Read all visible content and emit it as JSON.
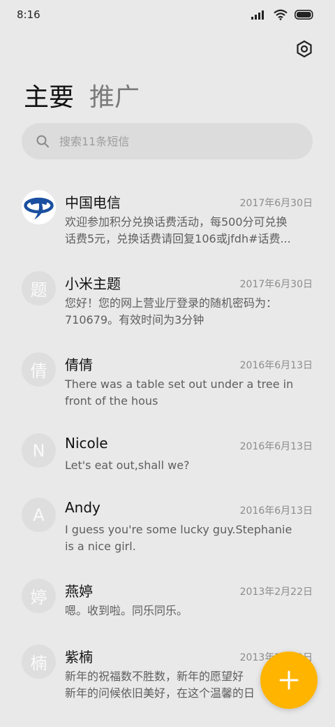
{
  "status_bar": {
    "time": "8:16"
  },
  "tabs": [
    {
      "label": "主要",
      "active": true
    },
    {
      "label": "推广",
      "active": false
    }
  ],
  "search": {
    "placeholder": "搜索11条短信"
  },
  "icons": {
    "settings": "hexagon-settings-icon",
    "search": "search-icon",
    "compose": "plus-icon",
    "telecom_logo": "china-telecom-logo"
  },
  "colors": {
    "accent": "#ffb400",
    "telecom_blue": "#1a4fa0"
  },
  "conversations": [
    {
      "avatar": "",
      "name": "中国电信",
      "date": "2017年6月30日",
      "preview": [
        "欢迎参加积分兑换话费活动，每500分可兑换",
        "话费5元，兑换话费请回复106或jfdh#话费..."
      ]
    },
    {
      "avatar": "题",
      "name": "小米主题",
      "date": "2017年6月30日",
      "preview": [
        "您好！您的网上营业厅登录的随机密码为：",
        "710679。有效时间为3分钟"
      ]
    },
    {
      "avatar": "倩",
      "name": "倩倩",
      "date": "2016年6月13日",
      "preview": [
        "There was a table set out under a tree in",
        "front of the hous"
      ]
    },
    {
      "avatar": "N",
      "name": "Nicole",
      "date": "2016年6月13日",
      "preview": [
        "Let's eat out,shall we?"
      ]
    },
    {
      "avatar": "A",
      "name": "Andy",
      "date": "2016年6月13日",
      "preview": [
        "I guess you're some lucky guy.Stephanie",
        "is a nice girl."
      ]
    },
    {
      "avatar": "婷",
      "name": "燕婷",
      "date": "2013年2月22日",
      "preview": [
        "嗯。收到啦。同乐同乐。"
      ]
    },
    {
      "avatar": "楠",
      "name": "紫楠",
      "date": "2013年2月22日",
      "preview": [
        "新年的祝福数不胜数，新年的愿望好",
        "新年的问候依旧美好，在这个温馨的日"
      ]
    }
  ]
}
